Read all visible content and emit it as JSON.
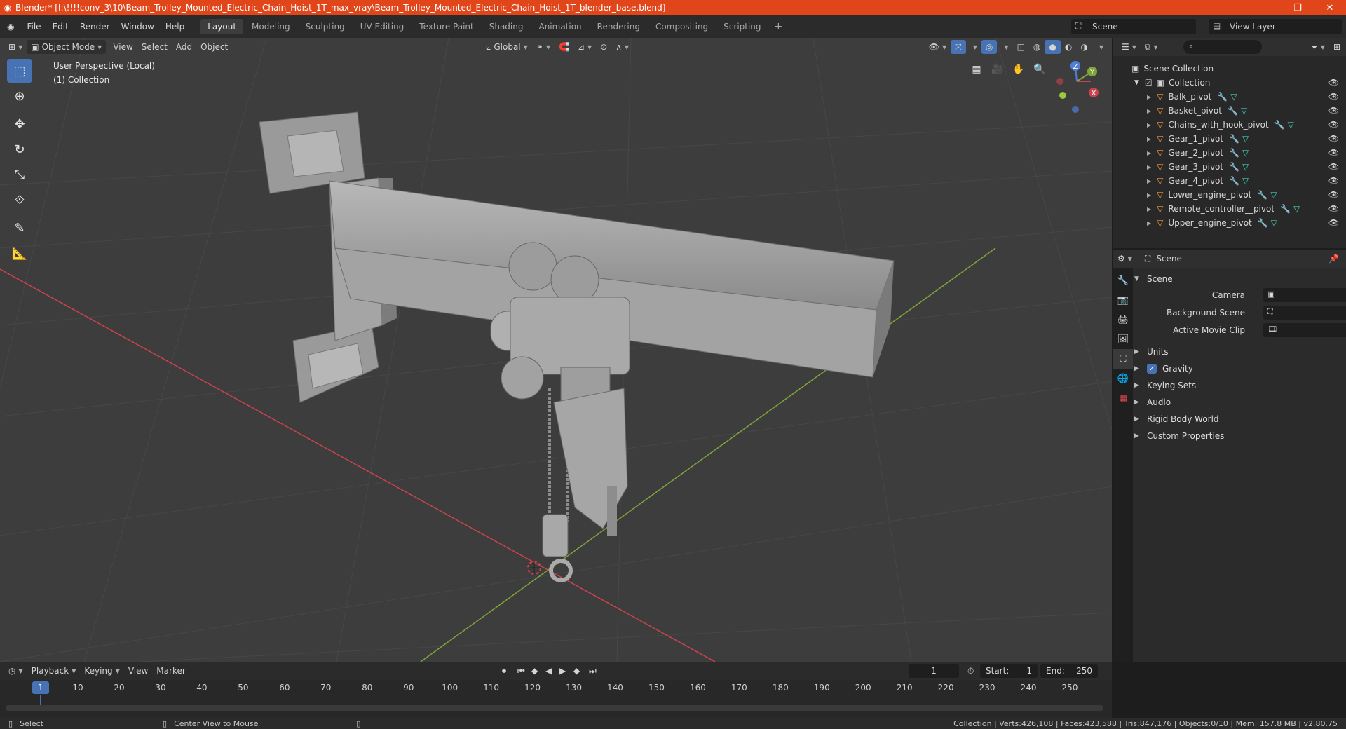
{
  "window": {
    "title": "Blender* [I:\\!!!!conv_3\\10\\Beam_Trolley_Mounted_Electric_Chain_Hoist_1T_max_vray\\Beam_Trolley_Mounted_Electric_Chain_Hoist_1T_blender_base.blend]",
    "minimize": "–",
    "maximize": "❐",
    "close": "✕"
  },
  "menu": {
    "items": [
      "File",
      "Edit",
      "Render",
      "Window",
      "Help"
    ],
    "workspaces": [
      "Layout",
      "Modeling",
      "Sculpting",
      "UV Editing",
      "Texture Paint",
      "Shading",
      "Animation",
      "Rendering",
      "Compositing",
      "Scripting"
    ],
    "active_workspace": "Layout",
    "add_tab": "+",
    "scene": "Scene",
    "view_layer": "View Layer"
  },
  "viewport": {
    "mode": "Object Mode",
    "menus": [
      "View",
      "Select",
      "Add",
      "Object"
    ],
    "orientation": "Global",
    "perspective_label": "User Perspective (Local)",
    "collection_label": "(1) Collection",
    "gizmo_axes": [
      "X",
      "Y",
      "Z"
    ],
    "colors": {
      "bg": "#3d3d3d",
      "x_axis": "#c9434e",
      "y_axis": "#7ea43a",
      "accent": "#4772b3"
    }
  },
  "outliner": {
    "root": "Scene Collection",
    "collection": "Collection",
    "objects": [
      "Balk_pivot",
      "Basket_pivot",
      "Chains_with_hook_pivot",
      "Gear_1_pivot",
      "Gear_2_pivot",
      "Gear_3_pivot",
      "Gear_4_pivot",
      "Lower_engine_pivot",
      "Remote_controller__pivot",
      "Upper_engine_pivot"
    ]
  },
  "properties": {
    "header": "Scene",
    "panel": "Scene",
    "fields": [
      {
        "label": "Camera"
      },
      {
        "label": "Background Scene"
      },
      {
        "label": "Active Movie Clip"
      }
    ],
    "subpanels": [
      "Units",
      "Gravity",
      "Keying Sets",
      "Audio",
      "Rigid Body World",
      "Custom Properties"
    ],
    "gravity_checked": true
  },
  "timeline": {
    "menus": [
      "Playback",
      "Keying",
      "View",
      "Marker"
    ],
    "current_frame": "1",
    "start_label": "Start:",
    "start": "1",
    "end_label": "End:",
    "end": "250",
    "ticks": [
      "10",
      "20",
      "30",
      "40",
      "50",
      "60",
      "70",
      "80",
      "90",
      "100",
      "110",
      "120",
      "130",
      "140",
      "150",
      "160",
      "170",
      "180",
      "190",
      "200",
      "210",
      "220",
      "230",
      "240",
      "250"
    ],
    "playhead": "1"
  },
  "status": {
    "left": "Select",
    "middle": "Center View to Mouse",
    "right": "Collection | Verts:426,108 | Faces:423,588 | Tris:847,176 | Objects:0/10 | Mem: 157.8 MB | v2.80.75"
  }
}
